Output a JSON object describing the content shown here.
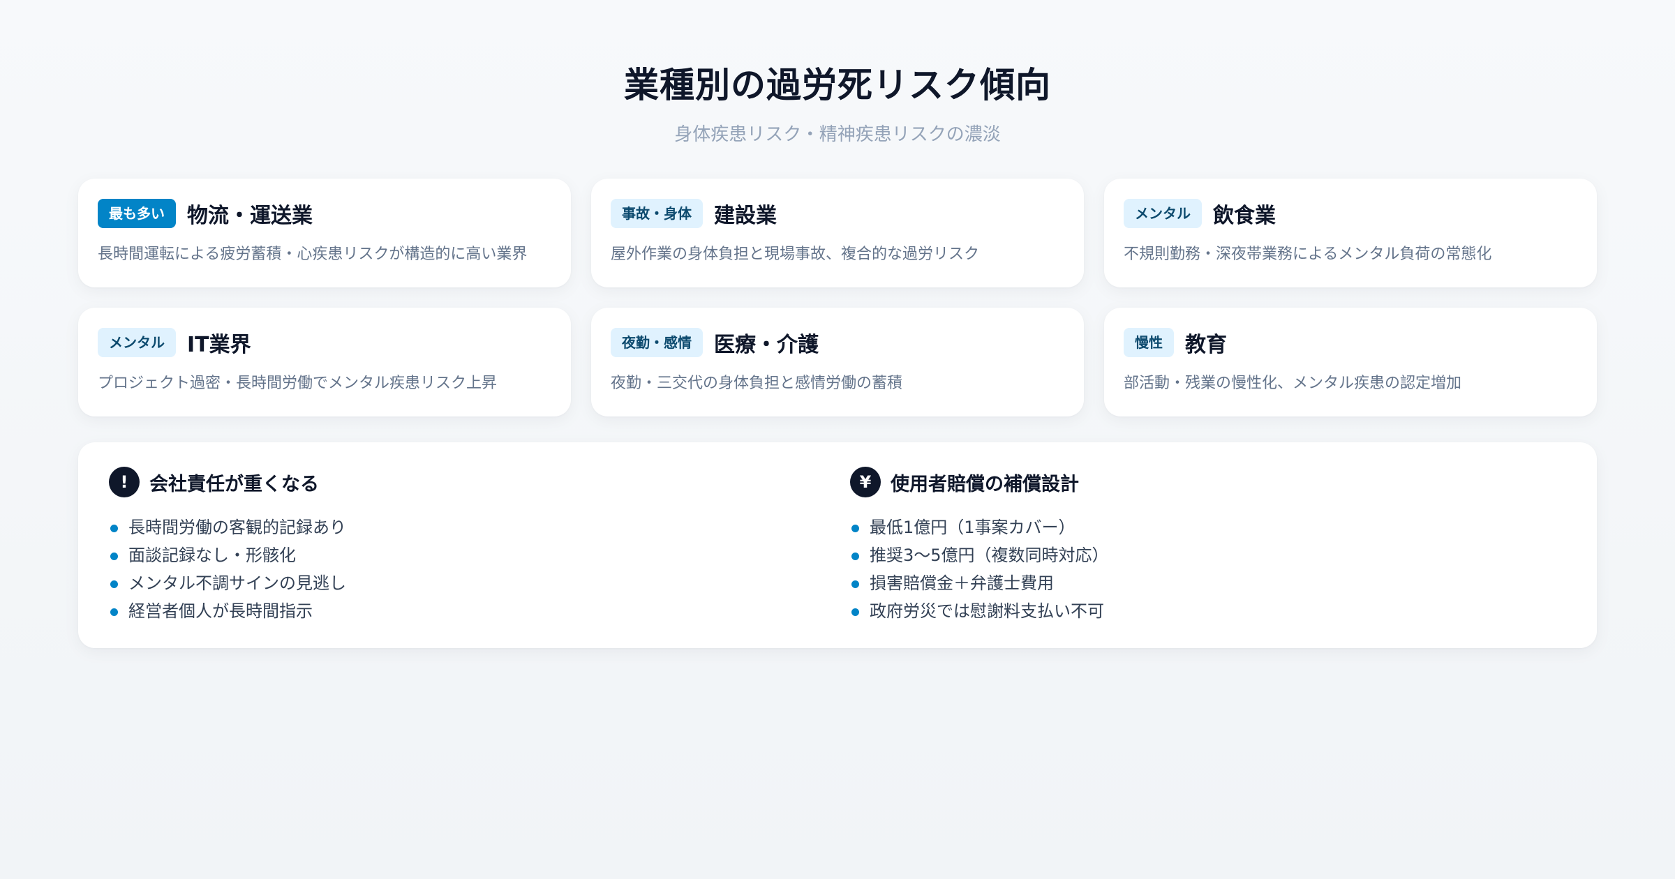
{
  "header": {
    "title": "業種別の過労死リスク傾向",
    "subtitle": "身体疾患リスク・精神疾患リスクの濃淡"
  },
  "cards": [
    {
      "badge": "最も多い",
      "title": "物流・運送業",
      "desc": "長時間運転による疲労蓄積・心疾患リスクが構造的に高い業界"
    },
    {
      "badge": "事故・身体",
      "title": "建設業",
      "desc": "屋外作業の身体負担と現場事故、複合的な過労リスク"
    },
    {
      "badge": "メンタル",
      "title": "飲食業",
      "desc": "不規則勤務・深夜帯業務によるメンタル負荷の常態化"
    },
    {
      "badge": "メンタル",
      "title": "IT業界",
      "desc": "プロジェクト過密・長時間労働でメンタル疾患リスク上昇"
    },
    {
      "badge": "夜勤・感情",
      "title": "医療・介護",
      "desc": "夜勤・三交代の身体負担と感情労働の蓄積"
    },
    {
      "badge": "慢性",
      "title": "教育",
      "desc": "部活動・残業の慢性化、メンタル疾患の認定増加"
    }
  ],
  "bottom": {
    "left": {
      "icon": "!",
      "icon_name": "exclamation-icon",
      "title": "会社責任が重くなる",
      "items": [
        "長時間労働の客観的記録あり",
        "面談記録なし・形骸化",
        "メンタル不調サインの見逃し",
        "経営者個人が長時間指示"
      ]
    },
    "right": {
      "icon": "¥",
      "icon_name": "yen-icon",
      "title": "使用者賠償の補償設計",
      "items": [
        "最低1億円（1事案カバー）",
        "推奨3〜5億円（複数同時対応）",
        "損害賠償金＋弁護士費用",
        "政府労災では慰謝料支払い不可"
      ]
    }
  },
  "colors": {
    "accent": "#0284c7",
    "badge_bg": "#e0f2fe",
    "title": "#0f172a",
    "muted": "#64748b"
  }
}
